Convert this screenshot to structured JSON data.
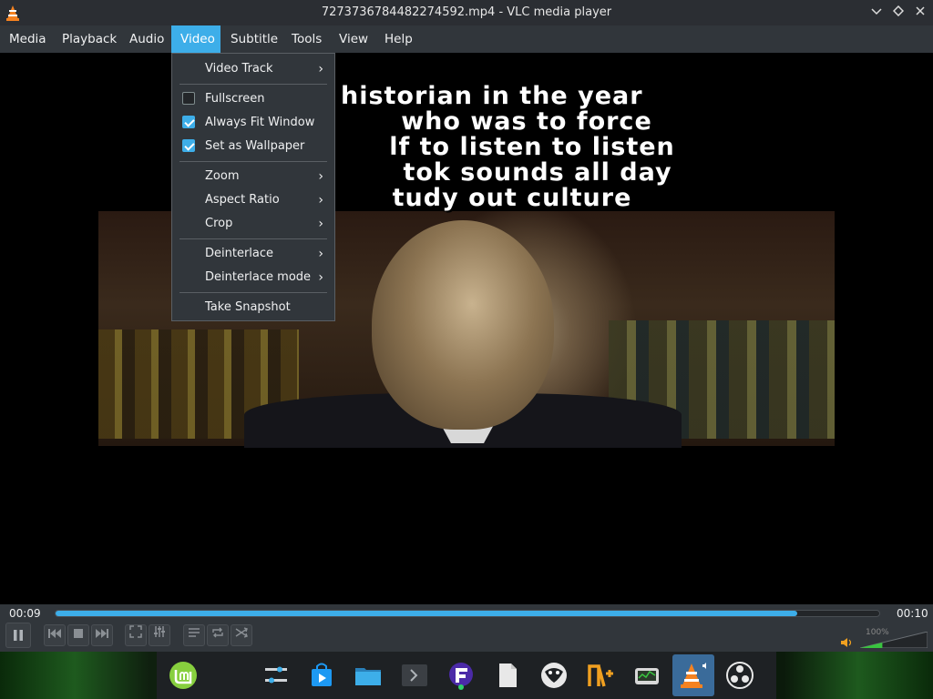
{
  "window": {
    "title": "7273736784482274592.mp4 - VLC media player",
    "buttons": [
      "minimize",
      "maximize",
      "close"
    ]
  },
  "menubar": {
    "items": [
      {
        "label": "Media"
      },
      {
        "label": "Playback"
      },
      {
        "label": "Audio"
      },
      {
        "label": "Video",
        "active": true
      },
      {
        "label": "Subtitle"
      },
      {
        "label": "Tools"
      },
      {
        "label": "View"
      },
      {
        "label": "Help"
      }
    ]
  },
  "video_menu": {
    "items": [
      {
        "label": "Video Track",
        "submenu": true
      },
      {
        "label": "Fullscreen",
        "checkbox": true,
        "checked": false
      },
      {
        "label": "Always Fit Window",
        "checkbox": true,
        "checked": true
      },
      {
        "label": "Set as Wallpaper",
        "checkbox": true,
        "checked": true
      },
      {
        "label": "Zoom",
        "submenu": true
      },
      {
        "label": "Aspect Ratio",
        "submenu": true
      },
      {
        "label": "Crop",
        "submenu": true
      },
      {
        "label": "Deinterlace",
        "submenu": true
      },
      {
        "label": "Deinterlace mode",
        "submenu": true
      },
      {
        "label": "Take Snapshot"
      }
    ]
  },
  "video": {
    "subtitle_lines": [
      "T           e historian in the year",
      "who was to force",
      "lf to listen to listen",
      "tok sounds all day",
      "tudy out culture"
    ]
  },
  "controls": {
    "elapsed": "00:09",
    "total": "00:10",
    "progress_fraction": 0.9,
    "volume_label": "100%",
    "volume_fraction": 1.0,
    "buttons": [
      "pause",
      "previous",
      "stop",
      "next",
      "fullscreen",
      "extended-settings",
      "playlist",
      "loop",
      "random"
    ]
  },
  "taskbar": {
    "apps": [
      "linux-mint-menu",
      "settings",
      "software-store",
      "file-manager",
      "terminal",
      "flathub-app",
      "text-editor",
      "game-app",
      "notepadqq",
      "system-monitor",
      "vlc",
      "obs-studio"
    ],
    "active": "vlc"
  },
  "colors": {
    "accent": "#3daee9",
    "menubar_bg": "#31363b",
    "titlebar_bg": "#2b2e33"
  }
}
